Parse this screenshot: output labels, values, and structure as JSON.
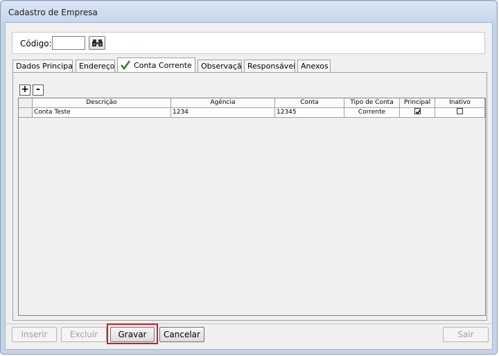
{
  "window": {
    "title": "Cadastro de Empresa"
  },
  "codigo": {
    "label": "Código:",
    "value": ""
  },
  "tabs": [
    {
      "label": "Dados Principais",
      "active": false
    },
    {
      "label": "Endereço",
      "active": false
    },
    {
      "label": "Conta Corrente",
      "active": true,
      "icon": "check-icon"
    },
    {
      "label": "Observação",
      "active": false
    },
    {
      "label": "Responsáveis",
      "active": false
    },
    {
      "label": "Anexos",
      "active": false
    }
  ],
  "grid": {
    "add_label": "+",
    "remove_label": "-",
    "columns": [
      "Descrição",
      "Agência",
      "Conta",
      "Tipo de Conta",
      "Principal",
      "Inativo"
    ],
    "rows": [
      {
        "descricao": "Conta Teste",
        "agencia": "1234",
        "conta": "12345",
        "tipo": "Corrente",
        "principal": true,
        "inativo": false
      }
    ]
  },
  "footer": {
    "inserir": "Inserir",
    "excluir": "Excluir",
    "gravar": "Gravar",
    "cancelar": "Cancelar",
    "sair": "Sair"
  },
  "colors": {
    "highlight": "#d9141b",
    "check": "#1e8a1e"
  }
}
